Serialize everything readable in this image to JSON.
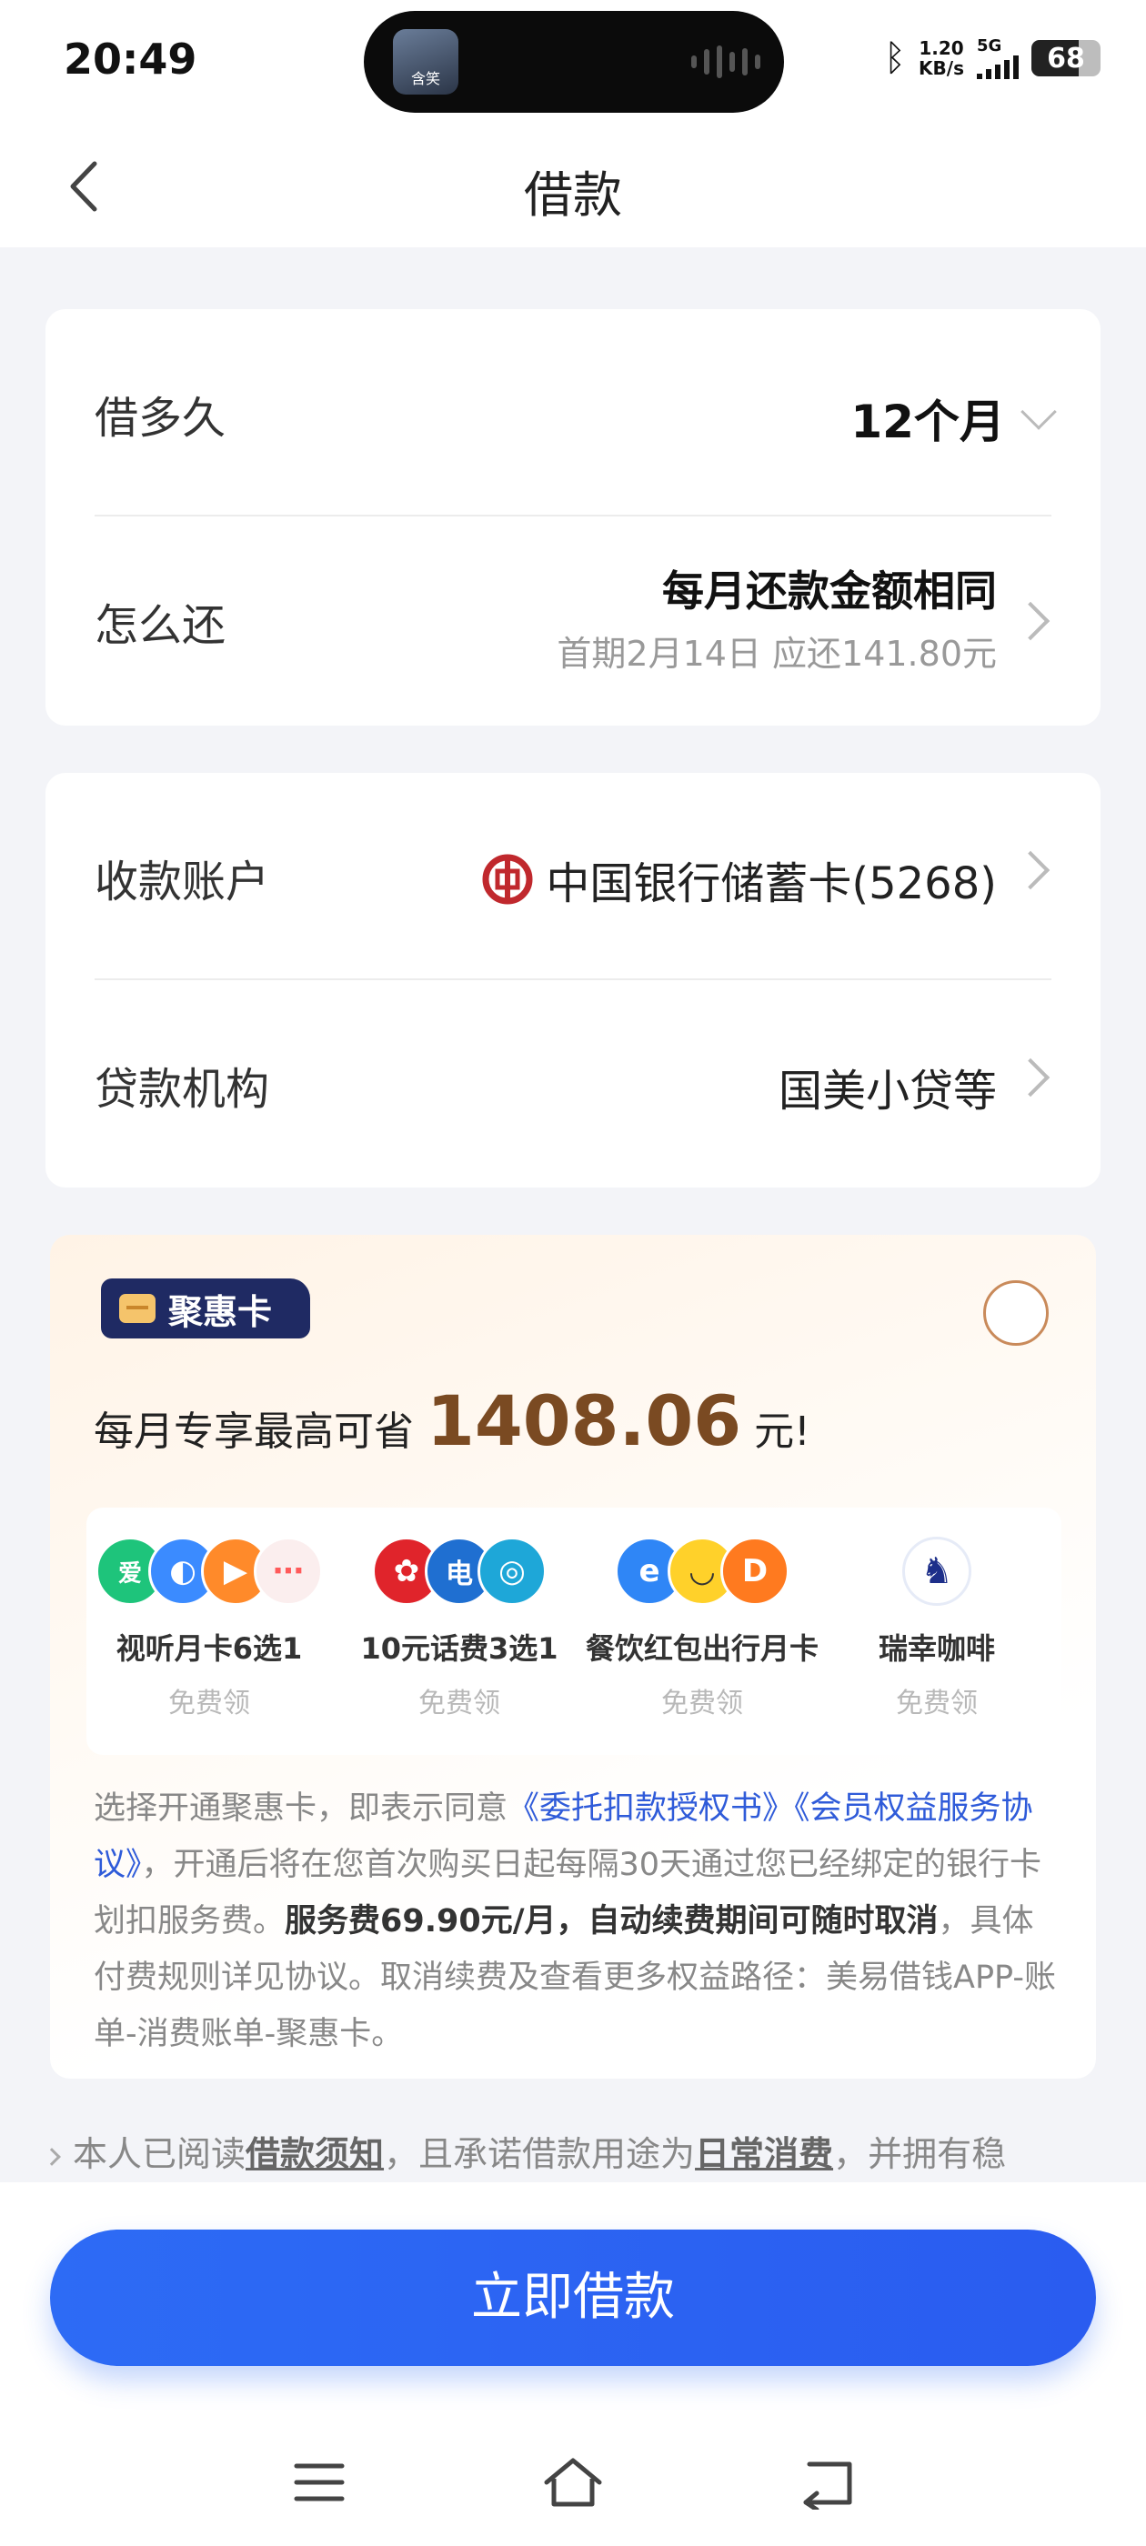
{
  "status_bar": {
    "time": "20:49",
    "island_thumb_text": "含笑",
    "net_speed_value": "1.20",
    "net_speed_unit": "KB/s",
    "network": "5G",
    "battery": "68",
    "battery_level": 0.68,
    "icons": [
      "bluetooth-icon",
      "signal-icon",
      "battery-icon"
    ]
  },
  "header": {
    "title": "借款",
    "back_icon": "chevron-left-icon"
  },
  "loan_card": {
    "term_label": "借多久",
    "term_value": "12个月",
    "repay_label": "怎么还",
    "repay_value": "每月还款金额相同",
    "repay_sub": "首期2月14日 应还141.80元"
  },
  "account_card": {
    "account_label": "收款账户",
    "account_value": "中国银行储蓄卡(5268)",
    "lender_label": "贷款机构",
    "lender_value": "国美小贷等"
  },
  "promo": {
    "badge": "聚惠卡",
    "headline_prefix": "每月专享最高可省",
    "headline_amount": "1408.06",
    "headline_suffix": "元!",
    "perks": [
      {
        "title": "视听月卡6选1",
        "sub": "免费领"
      },
      {
        "title": "10元话费3选1",
        "sub": "免费领"
      },
      {
        "title": "餐饮红包出行月卡",
        "sub": "免费领"
      },
      {
        "title": "瑞幸咖啡",
        "sub": "免费领"
      }
    ],
    "terms": {
      "t1": "选择开通聚惠卡，即表示同意",
      "link1": "《委托扣款授权书》",
      "link2": "《会员权益服务协议》",
      "t2": "，开通后将在您首次购买日起每隔30天通过您已经绑定的银行卡划扣服务费。",
      "bold": "服务费69.90元/月，自动续费期间可随时取消",
      "t3": "，具体付费规则详见协议。取消续费及查看更多权益路径：美易借钱APP-账单-消费账单-聚惠卡。"
    }
  },
  "agreement": {
    "t1": "本人已阅读",
    "link1": "借款须知",
    "t2": "，且承诺借款用途为",
    "link2": "日常消费",
    "t3": "，并拥有稳"
  },
  "cta": {
    "label": "立即借款"
  },
  "nav": {
    "icons": [
      "menu-icon",
      "home-icon",
      "back-icon"
    ]
  },
  "colors": {
    "accent": "#2d6bf5",
    "promo_amount": "#7a4a22",
    "link": "#2f5bd9",
    "badge_bg": "#1f2a63"
  }
}
